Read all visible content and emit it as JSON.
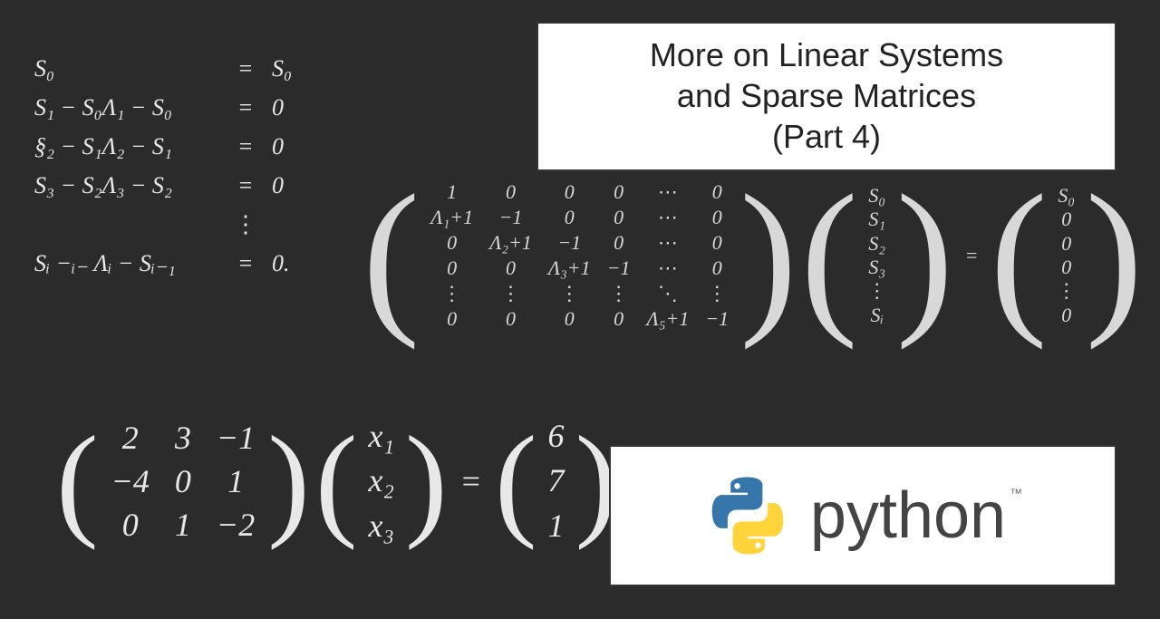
{
  "title": {
    "line1": "More on Linear Systems",
    "line2": "and Sparse Matrices",
    "line3": "(Part 4)"
  },
  "equations": {
    "rows": [
      {
        "lhs": "S₀",
        "rhs": "S₀"
      },
      {
        "lhs": "S₁ − S₀Λ₁ − S₀",
        "rhs": "0"
      },
      {
        "lhs": "§₂ − S₁Λ₂ − S₁",
        "rhs": "0"
      },
      {
        "lhs": "S₃ − S₂Λ₃ − S₂",
        "rhs": "0"
      },
      {
        "lhs": "Sᵢ −ᵢ₋ Λᵢ − Sᵢ₋₁",
        "rhs": "0."
      }
    ],
    "eq_sign": "="
  },
  "big_matrix": {
    "A": [
      [
        "1",
        "0",
        "0",
        "0",
        "⋯",
        "0"
      ],
      [
        "Λ₁+1",
        "−1",
        "0",
        "0",
        "⋯",
        "0"
      ],
      [
        "0",
        "Λ₂+1",
        "−1",
        "0",
        "⋯",
        "0"
      ],
      [
        "0",
        "0",
        "Λ₃+1",
        "−1",
        "⋯",
        "0"
      ],
      [
        "⋮",
        "⋮",
        "⋮",
        "⋮",
        "⋱",
        "⋮"
      ],
      [
        "0",
        "0",
        "0",
        "0",
        "Λ₅+1",
        "−1"
      ]
    ],
    "x": [
      "S₀",
      "S₁",
      "S₂",
      "S₃",
      "⋮",
      "Sᵢ"
    ],
    "b": [
      "S₀",
      "0",
      "0",
      "0",
      "⋮",
      "0"
    ],
    "eq_sign": "="
  },
  "small_matrix": {
    "A": [
      [
        "2",
        "3",
        "−1"
      ],
      [
        "−4",
        "0",
        "1"
      ],
      [
        "0",
        "1",
        "−2"
      ]
    ],
    "x": [
      "x₁",
      "x₂",
      "x₃"
    ],
    "b": [
      "6",
      "7",
      "1"
    ],
    "eq_sign": "="
  },
  "logo": {
    "text": "python",
    "tm": "™"
  }
}
